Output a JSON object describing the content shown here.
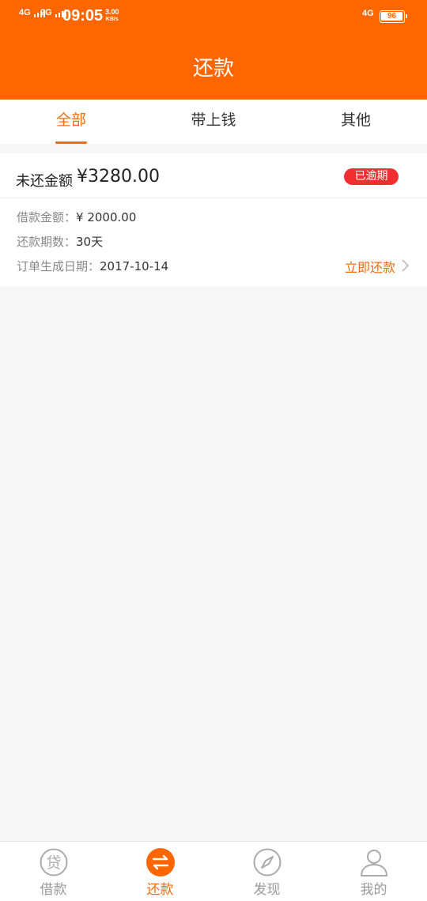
{
  "status_bar": {
    "network1": "4G",
    "network2": "2G",
    "time": "09:05",
    "speed_value": "3.00",
    "speed_unit": "KB/s",
    "network_right": "4G",
    "battery": "96"
  },
  "header": {
    "title": "还款"
  },
  "tabs": [
    {
      "label": "全部",
      "active": true
    },
    {
      "label": "带上钱",
      "active": false
    },
    {
      "label": "其他",
      "active": false
    }
  ],
  "loan_card": {
    "unpaid_label": "未还金额",
    "unpaid_amount": "¥3280.00",
    "status_badge": "已逾期",
    "loan_amount_label": "借款金额：",
    "loan_amount": "¥ 2000.00",
    "term_label": "还款期数：",
    "term": "30天",
    "order_date_label": "订单生成日期：",
    "order_date": "2017-10-14",
    "repay_action": "立即还款"
  },
  "bottom_nav": [
    {
      "label": "借款",
      "icon": "loan-icon",
      "active": false
    },
    {
      "label": "还款",
      "icon": "repay-exchange-icon",
      "active": true
    },
    {
      "label": "发现",
      "icon": "compass-icon",
      "active": false
    },
    {
      "label": "我的",
      "icon": "user-icon",
      "active": false
    }
  ],
  "colors": {
    "brand": "#ff6600",
    "accent": "#f26b0f",
    "overdue": "#f03030"
  }
}
